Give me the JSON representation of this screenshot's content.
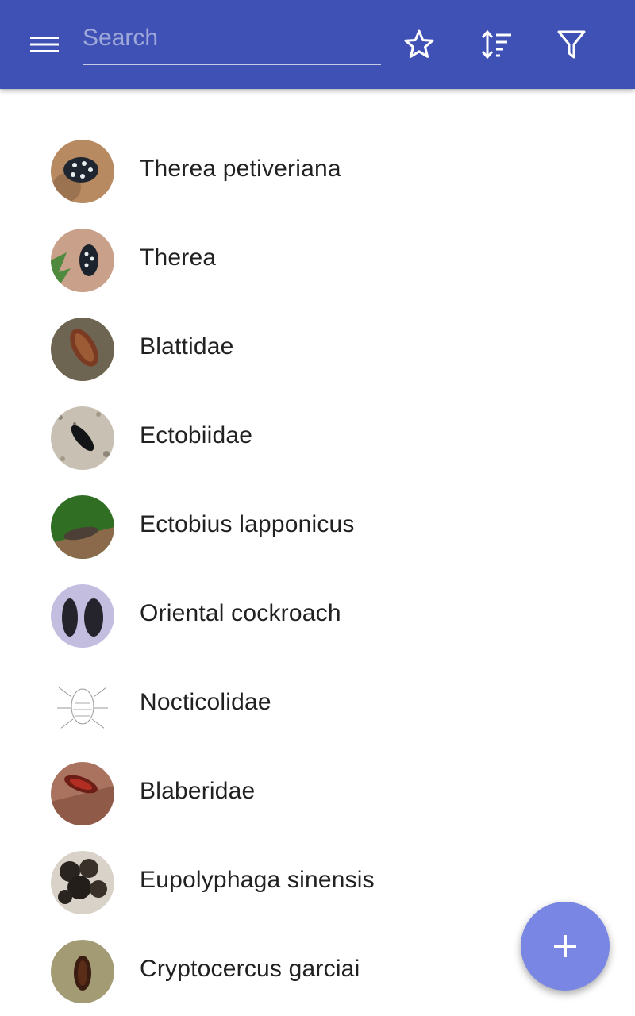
{
  "toolbar": {
    "search": {
      "placeholder": "Search",
      "value": ""
    },
    "icons": [
      "menu-icon",
      "star-icon",
      "sort-icon",
      "filter-icon"
    ]
  },
  "list": {
    "items": [
      {
        "label": "Therea petiveriana",
        "thumb": "insect-photo"
      },
      {
        "label": "Therea",
        "thumb": "insect-photo"
      },
      {
        "label": "Blattidae",
        "thumb": "insect-photo"
      },
      {
        "label": "Ectobiidae",
        "thumb": "insect-photo"
      },
      {
        "label": "Ectobius lapponicus",
        "thumb": "insect-photo"
      },
      {
        "label": "Oriental cockroach",
        "thumb": "insect-photo"
      },
      {
        "label": "Nocticolidae",
        "thumb": "insect-drawing"
      },
      {
        "label": "Blaberidae",
        "thumb": "insect-photo"
      },
      {
        "label": "Eupolyphaga sinensis",
        "thumb": "insect-photo"
      },
      {
        "label": "Cryptocercus garciai",
        "thumb": "insect-photo"
      }
    ]
  },
  "fab": {
    "icon": "plus-icon"
  },
  "colors": {
    "appbar": "#3f51b5",
    "fab": "#7986e3",
    "text": "#212121"
  }
}
